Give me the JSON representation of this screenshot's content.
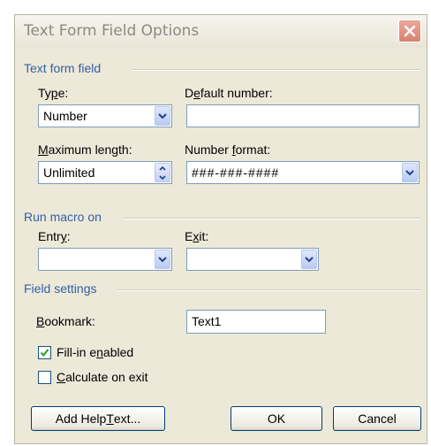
{
  "dialog": {
    "title": "Text Form Field Options",
    "close_icon": "close-icon"
  },
  "text_form_field": {
    "section_label": "Text form field",
    "type": {
      "label_pre": "Ty",
      "label_u": "p",
      "label_post": "e:",
      "value": "Number"
    },
    "default_number": {
      "label_pre": "D",
      "label_u": "e",
      "label_post": "fault number:",
      "value": ""
    },
    "maximum_length": {
      "label_pre": "",
      "label_u": "M",
      "label_post": "aximum length:",
      "value": "Unlimited"
    },
    "number_format": {
      "label_pre": "Number ",
      "label_u": "f",
      "label_post": "ormat:",
      "value": "###-###-####"
    }
  },
  "run_macro_on": {
    "section_label": "Run macro on",
    "entry": {
      "label_pre": "Entr",
      "label_u": "y",
      "label_post": ":",
      "value": ""
    },
    "exit": {
      "label_pre": "E",
      "label_u": "x",
      "label_post": "it:",
      "value": ""
    }
  },
  "field_settings": {
    "section_label": "Field settings",
    "bookmark": {
      "label_pre": "",
      "label_u": "B",
      "label_post": "ookmark:",
      "value": "Text1"
    },
    "fill_in_enabled": {
      "label_pre": "Fill-in e",
      "label_u": "n",
      "label_post": "abled",
      "checked": true
    },
    "calculate_on_exit": {
      "label_pre": "",
      "label_u": "C",
      "label_post": "alculate on exit",
      "checked": false
    }
  },
  "buttons": {
    "add_help_text": {
      "label_pre": "Add Help ",
      "label_u": "T",
      "label_post": "ext..."
    },
    "ok": "OK",
    "cancel": "Cancel"
  },
  "colors": {
    "section_heading": "#335ea8",
    "dialog_bg": "#ece9d8",
    "input_border": "#7f9db9",
    "button_border": "#003c74",
    "check_mark": "#21a121"
  }
}
